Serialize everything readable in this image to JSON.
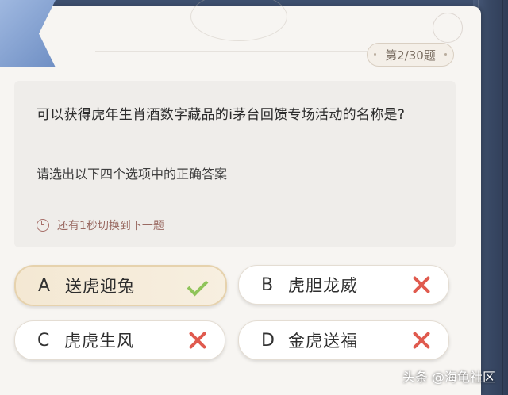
{
  "quiz": {
    "counter": "第2/30题",
    "question": "可以获得虎年生肖酒数字藏品的i茅台回馈专场活动的名称是?",
    "hint": "请选出以下四个选项中的正确答案",
    "timer": "还有1秒切换到下一题"
  },
  "options": [
    {
      "letter": "A",
      "text": "送虎迎兔",
      "state": "correct"
    },
    {
      "letter": "B",
      "text": "虎胆龙威",
      "state": "wrong"
    },
    {
      "letter": "C",
      "text": "虎虎生风",
      "state": "wrong"
    },
    {
      "letter": "D",
      "text": "金虎送福",
      "state": "wrong"
    }
  ],
  "watermark": "头条 @海龟社区",
  "colors": {
    "background": "#3d4f6e",
    "page": "#f7f5f2",
    "correct": "#8fc45a",
    "wrong": "#e05a4e"
  }
}
